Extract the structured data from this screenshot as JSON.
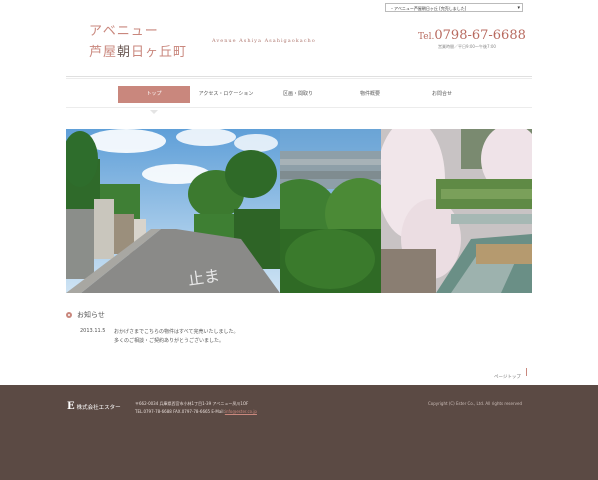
{
  "header": {
    "select_value": "・アベニュー芦屋朝日ヶ丘 [完売しました]",
    "logo_line1": "アベニュー",
    "logo_line2_a": "芦屋",
    "logo_line2_b": "朝",
    "logo_line2_c": "日ヶ丘町",
    "tagline": "Avenue Ashiya Asahigaokacho",
    "tel_prefix": "Tel.",
    "tel_number": "0798-67-6688",
    "hours": "営業時間／平日9:00～午後7:00"
  },
  "nav": {
    "items": [
      {
        "label": "トップ"
      },
      {
        "label": "アクセス・ロケーション"
      },
      {
        "label": "区画・間取り"
      },
      {
        "label": "物件概要"
      },
      {
        "label": "お問合せ"
      }
    ]
  },
  "news": {
    "heading": "お知らせ",
    "date": "2013.11.5",
    "line1": "おかげさまでこちらの物件はすべて完売いたしました。",
    "line2": "多くのご相談・ご契約ありがとうございました。"
  },
  "pagetop": "ページトップ",
  "footer": {
    "company": "株式会社エスター",
    "logo_mark": "E",
    "address": "〒662-0034 兵庫県西宮市小林1丁目1-39 アベニュー夙川1OF",
    "tel_fax": "TEL.0797-78-6688 FAX.0797-78-6665",
    "mail_label": "E-Mail:",
    "mail": "info@ester.co.jp",
    "copyright": "Copyright (C) Ester Co., Ltd. All rights reserved"
  },
  "colors": {
    "accent": "#c9877d",
    "footer_bg": "#5b4a44"
  }
}
